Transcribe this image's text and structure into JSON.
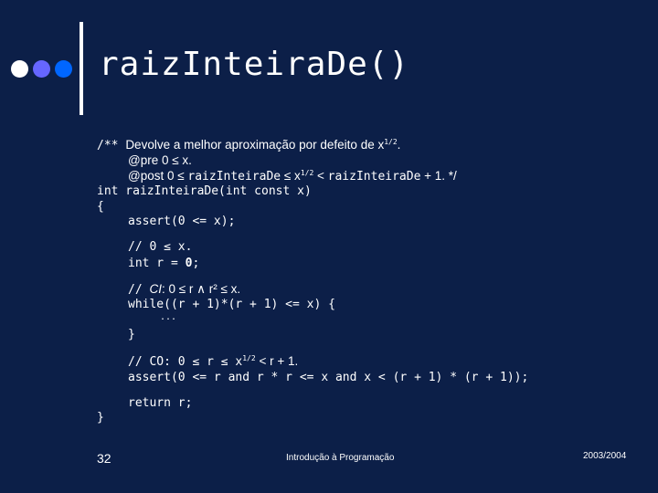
{
  "slide": {
    "title": "raizInteiraDe()",
    "bullets": [
      {
        "name": "bullet-white",
        "color": "#ffffff"
      },
      {
        "name": "bullet-lavender",
        "color": "#6666ff"
      },
      {
        "name": "bullet-blue",
        "color": "#0066ff"
      }
    ],
    "accent_bar_color": "#ffffff",
    "background_color": "#0c1f48"
  },
  "code": {
    "doc_open": "/** ",
    "doc_line1_text": "Devolve a melhor aproximação por defeito de x",
    "doc_line1_sup": "1/2",
    "doc_line1_end": ".",
    "doc_pre": "@pre 0 ≤ x.",
    "doc_post_a": "@post 0 ≤ ",
    "doc_post_b": "raizInteiraDe",
    "doc_post_c": " ≤ x",
    "doc_post_sup": "1/2",
    "doc_post_d": " < ",
    "doc_post_e": "raizInteiraDe",
    "doc_post_f": " + 1. */",
    "signature": "int raizInteiraDe(int const x)",
    "open_brace": "{",
    "assert_pre": "assert(0 <= x);",
    "comment_x": "// 0 ≤ x.",
    "init_a": "int r = ",
    "init_b": "0",
    "init_c": ";",
    "comment_ci_a": "// ",
    "comment_ci_b": "CI",
    "comment_ci_c": ": 0 ≤ r ∧ r² ≤ x.",
    "while_line": "while((r + 1)*(r + 1) <= x) {",
    "ellipsis": "...",
    "close_while": "}",
    "comment_co_a": "// CO: 0 ≤ r ≤ x",
    "comment_co_sup": "1/2",
    "comment_co_b": " < r + 1.",
    "assert_post": "assert(0 <= r and r * r <= x and x < (r + 1) * (r + 1));",
    "return_line": "return r;",
    "close_brace": "}"
  },
  "footer": {
    "page_number": "32",
    "course": "Introdução à Programação",
    "year": "2003/2004"
  }
}
